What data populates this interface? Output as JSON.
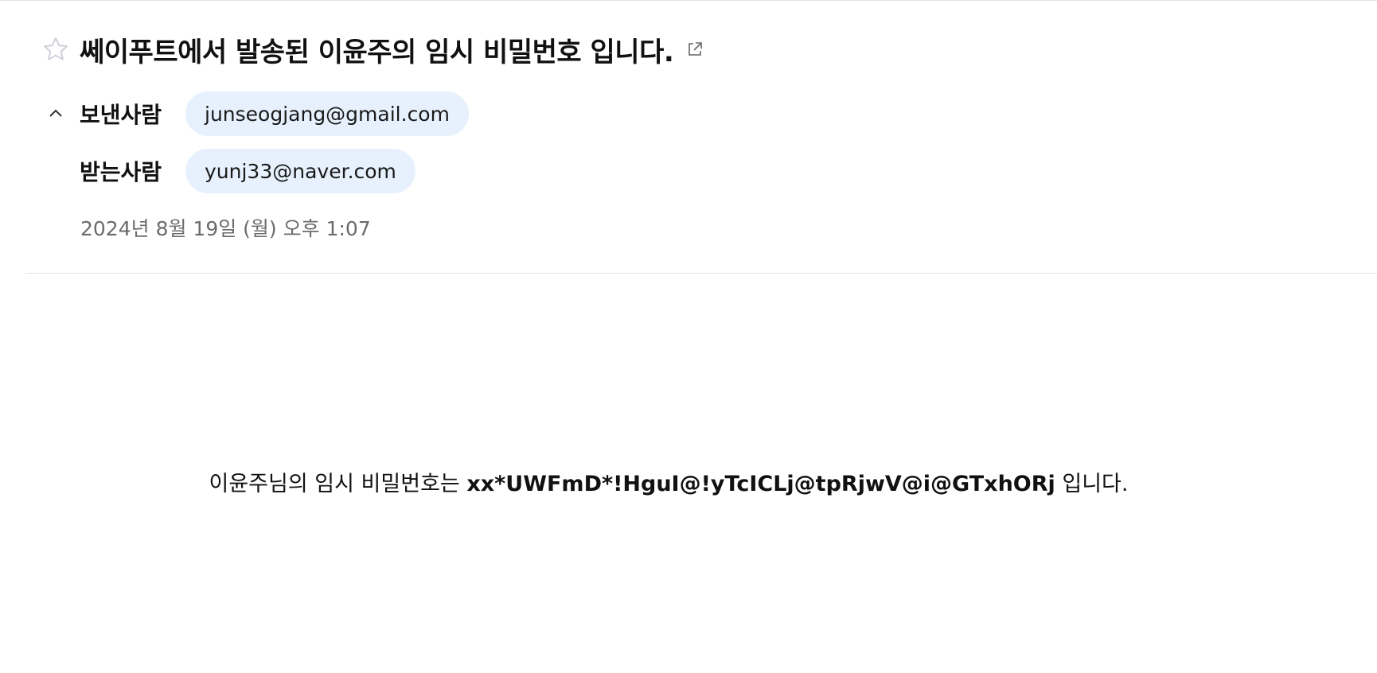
{
  "email": {
    "subject": "쎄이푸트에서 발송된 이윤주의 임시 비밀번호 입니다.",
    "from_label": "보낸사람",
    "from_address": "junseogjang@gmail.com",
    "to_label": "받는사람",
    "to_address": "yunj33@naver.com",
    "date": "2024년 8월 19일 (월) 오후 1:07"
  },
  "body": {
    "prefix": "이윤주님의 임시 비밀번호는 ",
    "password": "xx*UWFmD*!HguI@!yTcICLj@tpRjwV@i@GTxhORj",
    "suffix": " 입니다."
  },
  "icons": {
    "star": "star-outline-icon",
    "popout": "open-in-new-window-icon",
    "collapse": "chevron-up-icon"
  },
  "colors": {
    "chip_bg": "#e6f1fd",
    "star_outline": "#c9cdd6"
  }
}
